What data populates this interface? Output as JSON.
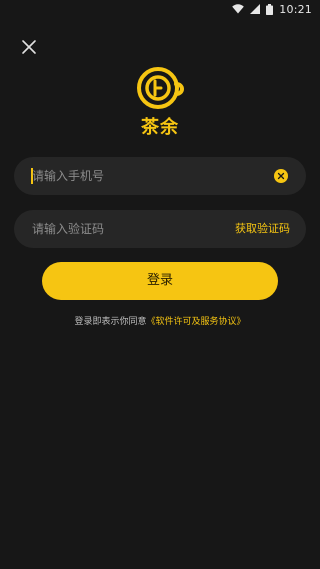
{
  "status_bar": {
    "time": "10:21",
    "icons": [
      "wifi-icon",
      "signal-icon",
      "battery-icon"
    ]
  },
  "header": {
    "close_icon": "close-icon"
  },
  "brand": {
    "logo_icon": "teapot-logo-icon",
    "name": "茶余"
  },
  "form": {
    "phone_placeholder": "请输入手机号",
    "phone_value": "",
    "code_placeholder": "请输入验证码",
    "code_value": "",
    "get_code_label": "获取验证码",
    "login_label": "登录"
  },
  "agreement": {
    "text": "登录即表示你同意",
    "link": "《软件许可及服务协议》"
  },
  "colors": {
    "accent": "#f6c512",
    "background": "#171717",
    "field_bg": "#262626"
  }
}
